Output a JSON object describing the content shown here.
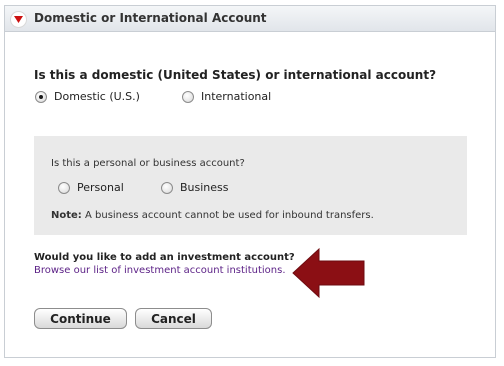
{
  "panel": {
    "title": "Domestic or International Account",
    "collapse_icon": "triangle-down-icon"
  },
  "account_location": {
    "question": "Is this a domestic (United States) or international account?",
    "options": [
      {
        "label": "Domestic (U.S.)",
        "selected": true
      },
      {
        "label": "International",
        "selected": false
      }
    ]
  },
  "account_type": {
    "question": "Is this a personal or business account?",
    "options": [
      {
        "label": "Personal",
        "selected": false
      },
      {
        "label": "Business",
        "selected": false
      }
    ],
    "note_label": "Note:",
    "note_text": " A business account cannot be used for inbound transfers."
  },
  "investment": {
    "question": "Would you like to add an investment account?",
    "link": "Browse our list of investment account institutions."
  },
  "buttons": {
    "continue": "Continue",
    "cancel": "Cancel"
  },
  "colors": {
    "arrow": "#8b0f14",
    "link": "#5a1f85",
    "collapse_icon": "#cc1111"
  }
}
